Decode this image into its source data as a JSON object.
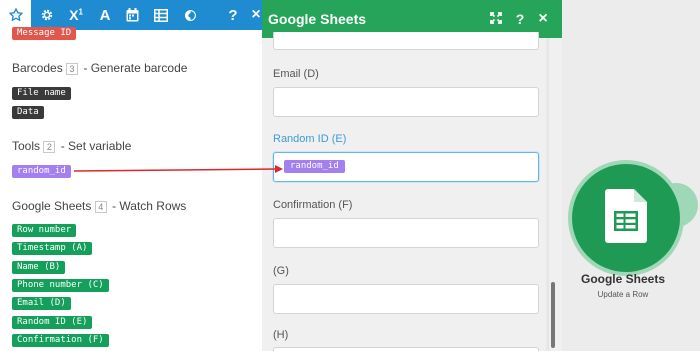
{
  "toolbar": {
    "icons": [
      "star-icon",
      "gear-icon",
      "superscript-icon",
      "text-icon",
      "calendar-icon",
      "table-icon",
      "contrast-icon",
      "help-icon",
      "close-icon"
    ],
    "superscript_label": "X",
    "superscript_sup": "1",
    "text_label": "A",
    "help_label": "?",
    "close_label": "×"
  },
  "mapping": {
    "top_pill": "Message ID",
    "groups": [
      {
        "name": "Barcodes",
        "num": "3",
        "action": "- Generate barcode",
        "pills": [
          "File name",
          "Data"
        ]
      },
      {
        "name": "Tools",
        "num": "2",
        "action": "- Set variable",
        "pills": [
          "random_id"
        ]
      },
      {
        "name": "Google Sheets",
        "num": "4",
        "action": "- Watch Rows",
        "pills": [
          "Row number",
          "Timestamp (A)",
          "Name (B)",
          "Phone number (C)",
          "Email (D)",
          "Random ID (E)",
          "Confirmation (F)"
        ]
      }
    ]
  },
  "form": {
    "title": "Google Sheets",
    "expand_label": "⤢",
    "help_label": "?",
    "close_label": "×",
    "fields": [
      {
        "label": "Email (D)",
        "value": ""
      },
      {
        "label": "Random ID (E)",
        "value": "random_id"
      },
      {
        "label": "Confirmation (F)",
        "value": ""
      },
      {
        "label": "(G)",
        "value": ""
      },
      {
        "label": "(H)",
        "value": ""
      }
    ]
  },
  "module": {
    "name": "Google Sheets",
    "action": "Update a Row",
    "color": "#1e9a55"
  },
  "colors": {
    "toolbar": "#1f8bd0",
    "form_header": "#25a45a",
    "pill_green": "#14a05b",
    "pill_purple": "#a47ff0",
    "pill_dark": "#3a3a3a",
    "pill_red": "#e2574c",
    "connector": "#e0262b"
  }
}
